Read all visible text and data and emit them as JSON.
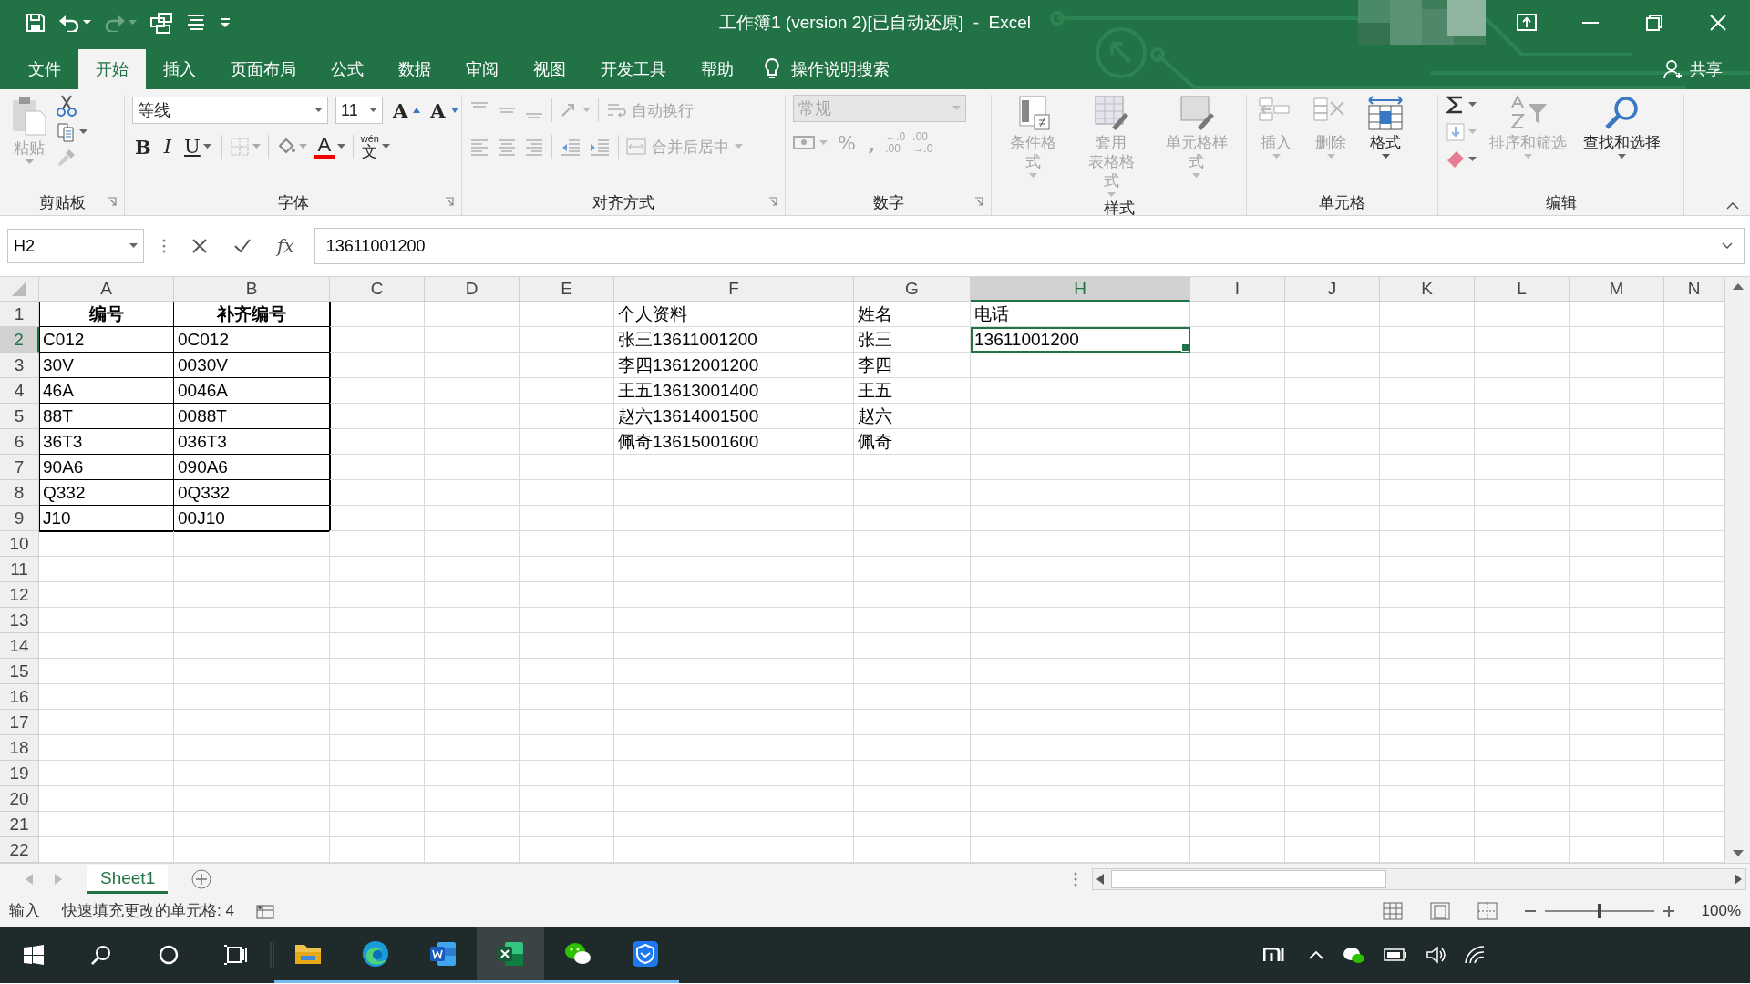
{
  "title_bar": {
    "title": "工作簿1 (version 2)[已自动还原]  -  Excel",
    "redo_disabled": true
  },
  "tabs": [
    {
      "label": "文件",
      "selected": false
    },
    {
      "label": "开始",
      "selected": true
    },
    {
      "label": "插入",
      "selected": false
    },
    {
      "label": "页面布局",
      "selected": false
    },
    {
      "label": "公式",
      "selected": false
    },
    {
      "label": "数据",
      "selected": false
    },
    {
      "label": "审阅",
      "selected": false
    },
    {
      "label": "视图",
      "selected": false
    },
    {
      "label": "开发工具",
      "selected": false
    },
    {
      "label": "帮助",
      "selected": false
    }
  ],
  "tell_me": "操作说明搜索",
  "share": "共享",
  "clipboard": {
    "label": "剪贴板",
    "paste": "粘贴",
    "paste_disabled": true,
    "painter_disabled": true
  },
  "font": {
    "label": "字体",
    "name": "等线",
    "size": "11",
    "grow": "A",
    "shrink": "A",
    "bold": "B",
    "italic": "I",
    "underline": "U",
    "color_label": "A",
    "phonetic": "wén",
    "phonetic_char": "文",
    "border_disabled": true
  },
  "alignment": {
    "label": "对齐方式",
    "wrap": "自动换行",
    "merge": "合并后居中",
    "disabled": true
  },
  "number": {
    "label": "数字",
    "format": "常规",
    "percent": "%",
    "comma": ",",
    "decimals": [
      {
        "top": "←.0",
        "bottom": ".00"
      },
      {
        "top": ".00",
        "bottom": "→.0"
      }
    ],
    "disabled": true
  },
  "styles": {
    "label": "样式",
    "buttons": [
      {
        "lines": [
          "条件格式"
        ],
        "disabled": true
      },
      {
        "lines": [
          "套用",
          "表格格式"
        ],
        "disabled": true
      },
      {
        "lines": [
          "单元格样式"
        ],
        "disabled": true
      }
    ]
  },
  "cells_group": {
    "label": "单元格",
    "buttons": [
      {
        "label": "插入",
        "disabled": true
      },
      {
        "label": "删除",
        "disabled": true
      },
      {
        "label": "格式",
        "disabled": false
      }
    ]
  },
  "editing": {
    "label": "编辑",
    "fill_disabled": true,
    "sort": {
      "label": "排序和筛选",
      "disabled": true
    },
    "find": {
      "label": "查找和选择",
      "disabled": false
    }
  },
  "formula_bar": {
    "name_box": "H2",
    "function_label": "fx",
    "formula": "13611001200"
  },
  "sheet": {
    "columns": [
      {
        "label": "A",
        "selected": false
      },
      {
        "label": "B",
        "selected": false
      },
      {
        "label": "C",
        "selected": false
      },
      {
        "label": "D",
        "selected": false
      },
      {
        "label": "E",
        "selected": false
      },
      {
        "label": "F",
        "selected": false
      },
      {
        "label": "G",
        "selected": false
      },
      {
        "label": "H",
        "selected": true
      },
      {
        "label": "I",
        "selected": false
      },
      {
        "label": "J",
        "selected": false
      },
      {
        "label": "K",
        "selected": false
      },
      {
        "label": "L",
        "selected": false
      },
      {
        "label": "M",
        "selected": false
      },
      {
        "label": "N",
        "selected": false
      }
    ],
    "rows": [
      {
        "label": "1",
        "selected": false,
        "cells": {
          "A": {
            "text": "编号",
            "bold": true,
            "bordered": true,
            "selected": false
          },
          "B": {
            "text": "补齐编号",
            "bold": true,
            "bordered": true,
            "selected": false
          },
          "F": {
            "text": "个人资料",
            "bold": false,
            "bordered": false,
            "selected": false
          },
          "G": {
            "text": "姓名",
            "bold": false,
            "bordered": false,
            "selected": false
          },
          "H": {
            "text": "电话",
            "bold": false,
            "bordered": false,
            "selected": false
          }
        }
      },
      {
        "label": "2",
        "selected": true,
        "cells": {
          "A": {
            "text": "C012",
            "bold": false,
            "bordered": true,
            "selected": false
          },
          "B": {
            "text": "0C012",
            "bold": false,
            "bordered": true,
            "selected": false
          },
          "F": {
            "text": "张三13611001200",
            "bold": false,
            "bordered": false,
            "selected": false
          },
          "G": {
            "text": "张三",
            "bold": false,
            "bordered": false,
            "selected": false
          },
          "H": {
            "text": "13611001200",
            "bold": false,
            "bordered": false,
            "selected": true
          }
        }
      },
      {
        "label": "3",
        "selected": false,
        "cells": {
          "A": {
            "text": "30V",
            "bold": false,
            "bordered": true,
            "selected": false
          },
          "B": {
            "text": "0030V",
            "bold": false,
            "bordered": true,
            "selected": false
          },
          "F": {
            "text": "李四13612001200",
            "bold": false,
            "bordered": false,
            "selected": false
          },
          "G": {
            "text": "李四",
            "bold": false,
            "bordered": false,
            "selected": false
          }
        }
      },
      {
        "label": "4",
        "selected": false,
        "cells": {
          "A": {
            "text": "46A",
            "bold": false,
            "bordered": true,
            "selected": false
          },
          "B": {
            "text": "0046A",
            "bold": false,
            "bordered": true,
            "selected": false
          },
          "F": {
            "text": "王五13613001400",
            "bold": false,
            "bordered": false,
            "selected": false
          },
          "G": {
            "text": "王五",
            "bold": false,
            "bordered": false,
            "selected": false
          }
        }
      },
      {
        "label": "5",
        "selected": false,
        "cells": {
          "A": {
            "text": "88T",
            "bold": false,
            "bordered": true,
            "selected": false
          },
          "B": {
            "text": "0088T",
            "bold": false,
            "bordered": true,
            "selected": false
          },
          "F": {
            "text": "赵六13614001500",
            "bold": false,
            "bordered": false,
            "selected": false
          },
          "G": {
            "text": "赵六",
            "bold": false,
            "bordered": false,
            "selected": false
          }
        }
      },
      {
        "label": "6",
        "selected": false,
        "cells": {
          "A": {
            "text": "36T3",
            "bold": false,
            "bordered": true,
            "selected": false
          },
          "B": {
            "text": "036T3",
            "bold": false,
            "bordered": true,
            "selected": false
          },
          "F": {
            "text": "佩奇13615001600",
            "bold": false,
            "bordered": false,
            "selected": false
          },
          "G": {
            "text": "佩奇",
            "bold": false,
            "bordered": false,
            "selected": false
          }
        }
      },
      {
        "label": "7",
        "selected": false,
        "cells": {
          "A": {
            "text": "90A6",
            "bold": false,
            "bordered": true,
            "selected": false
          },
          "B": {
            "text": "090A6",
            "bold": false,
            "bordered": true,
            "selected": false
          }
        }
      },
      {
        "label": "8",
        "selected": false,
        "cells": {
          "A": {
            "text": "Q332",
            "bold": false,
            "bordered": true,
            "selected": false
          },
          "B": {
            "text": "0Q332",
            "bold": false,
            "bordered": true,
            "selected": false
          }
        }
      },
      {
        "label": "9",
        "selected": false,
        "cells": {
          "A": {
            "text": "J10",
            "bold": false,
            "bordered": true,
            "selected": false
          },
          "B": {
            "text": "00J10",
            "bold": false,
            "bordered": true,
            "selected": false
          }
        }
      },
      {
        "label": "10",
        "selected": false,
        "cells": {}
      },
      {
        "label": "11",
        "selected": false,
        "cells": {}
      },
      {
        "label": "12",
        "selected": false,
        "cells": {}
      },
      {
        "label": "13",
        "selected": false,
        "cells": {}
      },
      {
        "label": "14",
        "selected": false,
        "cells": {}
      },
      {
        "label": "15",
        "selected": false,
        "cells": {}
      },
      {
        "label": "16",
        "selected": false,
        "cells": {}
      },
      {
        "label": "17",
        "selected": false,
        "cells": {}
      },
      {
        "label": "18",
        "selected": false,
        "cells": {}
      },
      {
        "label": "19",
        "selected": false,
        "cells": {}
      },
      {
        "label": "20",
        "selected": false,
        "cells": {}
      },
      {
        "label": "21",
        "selected": false,
        "cells": {}
      },
      {
        "label": "22",
        "selected": false,
        "cells": {}
      }
    ]
  },
  "sheet_tabs": [
    {
      "label": "Sheet1",
      "selected": true
    }
  ],
  "status_bar": {
    "mode": "输入",
    "message": "快速填充更改的单元格: 4",
    "zoom": "100%",
    "zoom_slider": {
      "level": 0.5
    }
  },
  "taskbar": {
    "apps": [
      {
        "kind": "explorer",
        "running": true,
        "active": false
      },
      {
        "kind": "edge",
        "running": true,
        "active": false
      },
      {
        "kind": "word",
        "running": true,
        "active": false
      },
      {
        "kind": "excel",
        "running": true,
        "active": true
      },
      {
        "kind": "wechat",
        "running": true,
        "active": false
      },
      {
        "kind": "shield",
        "running": true,
        "active": false
      }
    ]
  }
}
